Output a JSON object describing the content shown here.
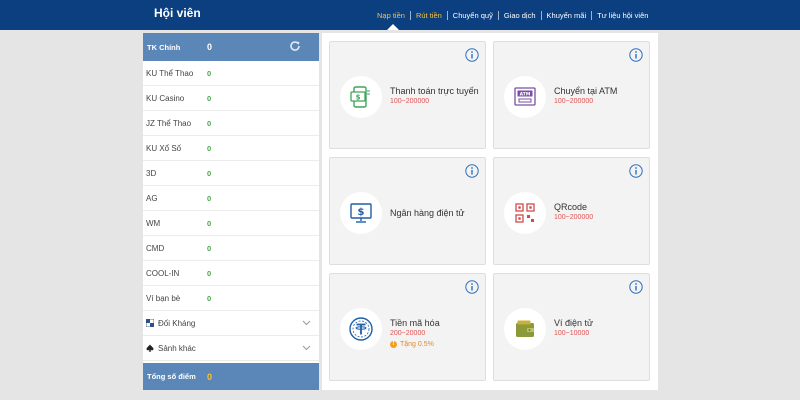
{
  "header": {
    "title": "Hội viên",
    "nav": [
      {
        "label": "Nạp tiền",
        "state": "active"
      },
      {
        "label": "Rút tiền",
        "state": "highlight"
      },
      {
        "label": "Chuyển quỹ",
        "state": ""
      },
      {
        "label": "Giao dịch",
        "state": ""
      },
      {
        "label": "Khuyến mãi",
        "state": ""
      },
      {
        "label": "Tư liệu hội viên",
        "state": ""
      }
    ]
  },
  "sidebar": {
    "main_account": {
      "label": "TK Chính",
      "value": "0"
    },
    "accounts": [
      {
        "label": "KU Thể Thao",
        "value": "0"
      },
      {
        "label": "KU Casino",
        "value": "0"
      },
      {
        "label": "JZ Thể Thao",
        "value": "0"
      },
      {
        "label": "KU Xổ Số",
        "value": "0"
      },
      {
        "label": "3D",
        "value": "0"
      },
      {
        "label": "AG",
        "value": "0"
      },
      {
        "label": "WM",
        "value": "0"
      },
      {
        "label": "CMD",
        "value": "0"
      },
      {
        "label": "COOL-IN",
        "value": "0"
      },
      {
        "label": "Ví bạn bè",
        "value": "0"
      }
    ],
    "groups": [
      {
        "label": "Đối Kháng",
        "icon": "chess-board-icon"
      },
      {
        "label": "Sảnh khác",
        "icon": "spade-icon"
      }
    ],
    "total": {
      "label": "Tổng số điểm",
      "value": "0"
    }
  },
  "methods": [
    {
      "name": "Thanh toán trực tuyến",
      "range": "100~200000",
      "icon": "mobile-payment-icon"
    },
    {
      "name": "Chuyển tại ATM",
      "range": "100~200000",
      "icon": "atm-icon"
    },
    {
      "name": "Ngân hàng điện tử",
      "range": "",
      "icon": "monitor-dollar-icon"
    },
    {
      "name": "QRcode",
      "range": "100~200000",
      "icon": "qr-icon"
    },
    {
      "name": "Tiền mã hóa",
      "range": "200~20000",
      "bonus": "Tặng 0.5%",
      "icon": "crypto-icon"
    },
    {
      "name": "Ví điện tử",
      "range": "100~10000",
      "icon": "wallet-icon"
    }
  ],
  "colors": {
    "header_bg": "#0b3f80",
    "accent_yellow": "#f5c242",
    "sidebar_head": "#5a87b8",
    "value_green": "#4ca44c",
    "range_red": "#e15353",
    "info_blue": "#2e6fbf"
  }
}
